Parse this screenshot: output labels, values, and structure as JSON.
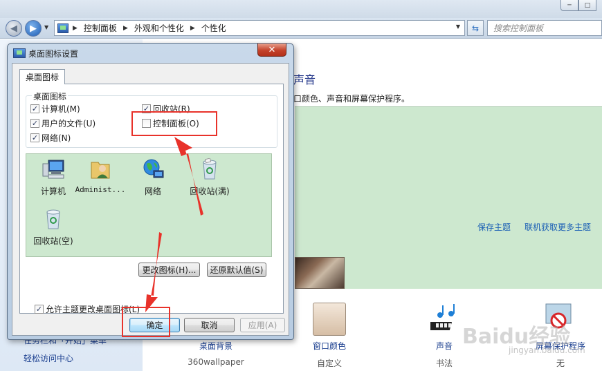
{
  "background_window": {
    "address_crumbs": [
      "控制面板",
      "外观和个性化",
      "个性化"
    ],
    "search_placeholder": "搜索控制面板",
    "heading": "声音",
    "subtitle": "口颜色、声音和屏幕保护程序。",
    "theme_links": [
      "保存主题",
      "联机获取更多主题"
    ],
    "left_links": [
      "任务栏和「开始」菜单",
      "轻松访问中心"
    ],
    "bottom_items": [
      {
        "label": "桌面背景",
        "value": "360wallpaper"
      },
      {
        "label": "窗口颜色",
        "value": "自定义"
      },
      {
        "label": "声音",
        "value": "书法"
      },
      {
        "label": "屏幕保护程序",
        "value": "无"
      }
    ],
    "watermark": "Baidu经验",
    "watermark_sub": "jingyan.baidu.com",
    "window_controls": [
      "─",
      "□"
    ]
  },
  "dialog": {
    "title": "桌面图标设置",
    "close_label": "✕",
    "tab_label": "桌面图标",
    "group_title": "桌面图标",
    "checkboxes": [
      {
        "label": "计算机(M)",
        "checked": true
      },
      {
        "label": "回收站(R)",
        "checked": true
      },
      {
        "label": "用户的文件(U)",
        "checked": true
      },
      {
        "label": "控制面板(O)",
        "checked": false
      },
      {
        "label": "网络(N)",
        "checked": true
      }
    ],
    "icons": [
      {
        "label": "计算机",
        "icon": "computer-icon"
      },
      {
        "label": "Administ...",
        "icon": "user-folder-icon"
      },
      {
        "label": "网络",
        "icon": "network-globe-icon"
      },
      {
        "label": "回收站(满)",
        "icon": "recycle-bin-full-icon"
      },
      {
        "label": "回收站(空)",
        "icon": "recycle-bin-empty-icon"
      }
    ],
    "change_icon_label": "更改图标(H)...",
    "restore_default_label": "还原默认值(S)",
    "allow_theme_label": "允许主题更改桌面图标(L)",
    "allow_theme_checked": true,
    "ok_label": "确定",
    "cancel_label": "取消",
    "apply_label": "应用(A)"
  },
  "colors": {
    "annotation_red": "#e8322a",
    "theme_green": "#cde8cf",
    "link_blue": "#1b5fb5"
  }
}
